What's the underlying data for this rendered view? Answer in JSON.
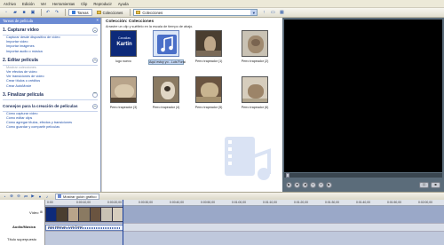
{
  "menu": {
    "items": [
      "Archivo",
      "Edición",
      "Ver",
      "Herramientas",
      "Clip",
      "Reproducir",
      "Ayuda"
    ]
  },
  "toolbar": {
    "tasks_label": "Tareas",
    "collections_label": "Colecciones",
    "collection_select_value": "Colecciones"
  },
  "taskpane": {
    "header": "Tareas de película",
    "close_glyph": "×",
    "sections": [
      {
        "title": "1. Capturar vídeo",
        "links": [
          {
            "label": "Capturar desde dispositivo de vídeo",
            "dim": false
          },
          {
            "label": "Importar vídeo",
            "dim": false
          },
          {
            "label": "Importar imágenes",
            "dim": false
          },
          {
            "label": "Importar audio o música",
            "dim": false
          }
        ]
      },
      {
        "title": "2. Editar película",
        "links": [
          {
            "label": "Mostrar colecciones",
            "dim": true
          },
          {
            "label": "Ver efectos de vídeo",
            "dim": false
          },
          {
            "label": "Ver transiciones de vídeo",
            "dim": false
          },
          {
            "label": "Crear títulos o créditos",
            "dim": false
          },
          {
            "label": "Crear AutoMovie",
            "dim": false
          }
        ]
      },
      {
        "title": "3. Finalizar película",
        "links": []
      },
      {
        "title": "Consejos para la creación de películas",
        "links": [
          {
            "label": "Cómo capturar vídeo",
            "dim": false
          },
          {
            "label": "Cómo editar clips",
            "dim": false
          },
          {
            "label": "Cómo agregar títulos, efectos y transiciones",
            "dim": false
          },
          {
            "label": "Cómo guardar y compartir películas",
            "dim": false
          }
        ]
      }
    ]
  },
  "collection": {
    "title": "Colección: Colecciones",
    "hint": "Arrastre un clip y suéltelo en la escala de tiempo de abajo.",
    "clips": [
      {
        "caption": "lugo nuevo",
        "kind": "logo",
        "selected": false,
        "logo_text_1": "Canallas",
        "logo_text_2": "Kartin"
      },
      {
        "caption": "Aqui estoy yo - Luis Fonsi",
        "kind": "music",
        "selected": true
      },
      {
        "caption": "Perro trapeador (1)",
        "kind": "dog",
        "selected": false
      },
      {
        "caption": "Perro trapeador (2)",
        "kind": "dog",
        "selected": false
      },
      {
        "caption": "Perro trapeador (3)",
        "kind": "dog",
        "selected": false
      },
      {
        "caption": "Perro trapeador (4)",
        "kind": "dog",
        "selected": false
      },
      {
        "caption": "Perro trapeador (5)",
        "kind": "dog",
        "selected": false
      },
      {
        "caption": "Perro trapeador (6)",
        "kind": "dog",
        "selected": false
      }
    ]
  },
  "timeline": {
    "storyboard_label": "Mostrar guión gráfico",
    "tracks": {
      "video": "Vídeo",
      "audio": "Audio/Música",
      "title": "Título superpuesto"
    },
    "ticks": [
      "0:00",
      "0:00:10,00",
      "0:00:20,00",
      "0:00:30,00",
      "0:00:40,00",
      "0:00:50,00",
      "0:01:00,00",
      "0:01:10,00",
      "0:01:20,00",
      "0:01:30,00",
      "0:01:40,00",
      "0:01:50,00",
      "0:02:00,00"
    ],
    "audio_clip": "Aqui estoy yo - Luis Fonsi"
  }
}
